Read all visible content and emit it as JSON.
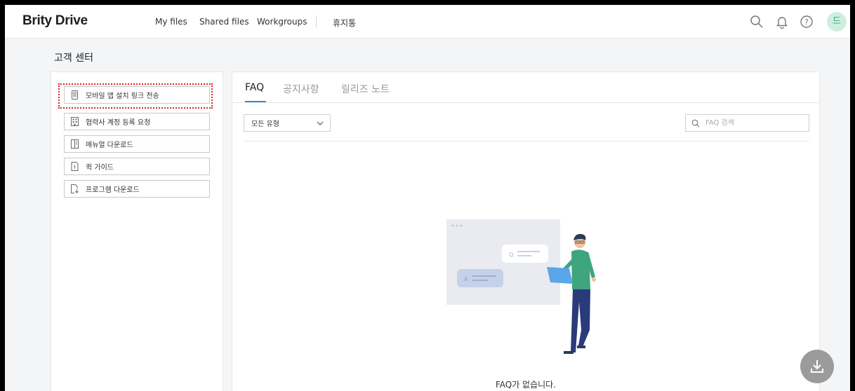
{
  "header": {
    "logo": "Brity Drive",
    "nav": [
      "My files",
      "Shared files",
      "Workgroups",
      "휴지통"
    ],
    "avatar_initial": "드"
  },
  "page": {
    "title": "고객 센터"
  },
  "sidebar": {
    "items": [
      {
        "label": "모바일 앱 설치 링크 전송",
        "icon": "mobile-icon"
      },
      {
        "label": "협력사 계정 등록 요청",
        "icon": "building-icon"
      },
      {
        "label": "매뉴얼 다운로드",
        "icon": "manual-icon"
      },
      {
        "label": "퀵 가이드",
        "icon": "document-icon"
      },
      {
        "label": "프로그램 다운로드",
        "icon": "file-download-icon"
      }
    ]
  },
  "main": {
    "tabs": [
      {
        "label": "FAQ",
        "active": true
      },
      {
        "label": "공지사항",
        "active": false
      },
      {
        "label": "릴리즈 노트",
        "active": false
      }
    ],
    "filter": {
      "selected": "모든 유형"
    },
    "search": {
      "placeholder": "FAQ 검색"
    },
    "empty_message": "FAQ가 없습니다."
  },
  "colors": {
    "accent": "#2d8ddc",
    "avatar_bg": "#cfeee1",
    "highlight": "#e02020"
  }
}
